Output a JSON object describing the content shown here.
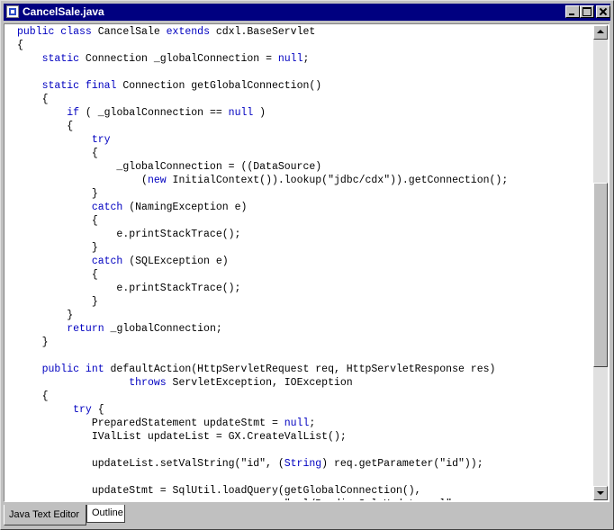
{
  "window": {
    "title": "CancelSale.java",
    "icon": "java-file-icon",
    "controls": [
      "minimize-icon",
      "maximize-icon",
      "close-icon"
    ]
  },
  "colors": {
    "titlebar": "#000080",
    "keyword": "#0000c0",
    "text": "#000000",
    "editor_bg": "#ffffff",
    "chrome": "#c0c0c0"
  },
  "code_lines": [
    [
      {
        "k": true,
        "t": "public class"
      },
      {
        "t": " CancelSale "
      },
      {
        "k": true,
        "t": "extends"
      },
      {
        "t": " cdxl.BaseServlet"
      }
    ],
    [
      {
        "t": "{"
      }
    ],
    [
      {
        "t": "    "
      },
      {
        "k": true,
        "t": "static"
      },
      {
        "t": " Connection _globalConnection = "
      },
      {
        "k": true,
        "t": "null"
      },
      {
        "t": ";"
      }
    ],
    [
      {
        "t": ""
      }
    ],
    [
      {
        "t": "    "
      },
      {
        "k": true,
        "t": "static final"
      },
      {
        "t": " Connection getGlobalConnection()"
      }
    ],
    [
      {
        "t": "    {"
      }
    ],
    [
      {
        "t": "        "
      },
      {
        "k": true,
        "t": "if"
      },
      {
        "t": " ( _globalConnection == "
      },
      {
        "k": true,
        "t": "null"
      },
      {
        "t": " )"
      }
    ],
    [
      {
        "t": "        {"
      }
    ],
    [
      {
        "t": "            "
      },
      {
        "k": true,
        "t": "try"
      }
    ],
    [
      {
        "t": "            {"
      }
    ],
    [
      {
        "t": "                _globalConnection = ((DataSource)"
      }
    ],
    [
      {
        "t": "                    ("
      },
      {
        "k": true,
        "t": "new"
      },
      {
        "t": " InitialContext()).lookup(\"jdbc/cdx\")).getConnection();"
      }
    ],
    [
      {
        "t": "            }"
      }
    ],
    [
      {
        "t": "            "
      },
      {
        "k": true,
        "t": "catch"
      },
      {
        "t": " (NamingException e)"
      }
    ],
    [
      {
        "t": "            {"
      }
    ],
    [
      {
        "t": "                e.printStackTrace();"
      }
    ],
    [
      {
        "t": "            }"
      }
    ],
    [
      {
        "t": "            "
      },
      {
        "k": true,
        "t": "catch"
      },
      {
        "t": " (SQLException e)"
      }
    ],
    [
      {
        "t": "            {"
      }
    ],
    [
      {
        "t": "                e.printStackTrace();"
      }
    ],
    [
      {
        "t": "            }"
      }
    ],
    [
      {
        "t": "        }"
      }
    ],
    [
      {
        "t": "        "
      },
      {
        "k": true,
        "t": "return"
      },
      {
        "t": " _globalConnection;"
      }
    ],
    [
      {
        "t": "    }"
      }
    ],
    [
      {
        "t": ""
      }
    ],
    [
      {
        "t": "    "
      },
      {
        "k": true,
        "t": "public int"
      },
      {
        "t": " defaultAction(HttpServletRequest req, HttpServletResponse res)"
      }
    ],
    [
      {
        "t": "                  "
      },
      {
        "k": true,
        "t": "throws"
      },
      {
        "t": " ServletException, IOException"
      }
    ],
    [
      {
        "t": "    {"
      }
    ],
    [
      {
        "t": "         "
      },
      {
        "k": true,
        "t": "try"
      },
      {
        "t": " {"
      }
    ],
    [
      {
        "t": "            PreparedStatement updateStmt = "
      },
      {
        "k": true,
        "t": "null"
      },
      {
        "t": ";"
      }
    ],
    [
      {
        "t": "            IValList updateList = GX.CreateValList();"
      }
    ],
    [
      {
        "t": ""
      }
    ],
    [
      {
        "t": "            updateList.setValString(\"id\", ("
      },
      {
        "k": true,
        "t": "String"
      },
      {
        "t": ") req.getParameter(\"id\"));"
      }
    ],
    [
      {
        "t": ""
      }
    ],
    [
      {
        "t": "            updateStmt = SqlUtil.loadQuery(getGlobalConnection(),"
      }
    ],
    [
      {
        "t": "                                           \"sql/PendingSaleUpdate.sql\","
      }
    ]
  ],
  "scrollbar": {
    "up_icon": "arrow-up-icon",
    "down_icon": "arrow-down-icon"
  },
  "tabs": [
    {
      "label": "Java Text Editor",
      "active": true
    },
    {
      "label": "Outline",
      "active": false
    }
  ]
}
